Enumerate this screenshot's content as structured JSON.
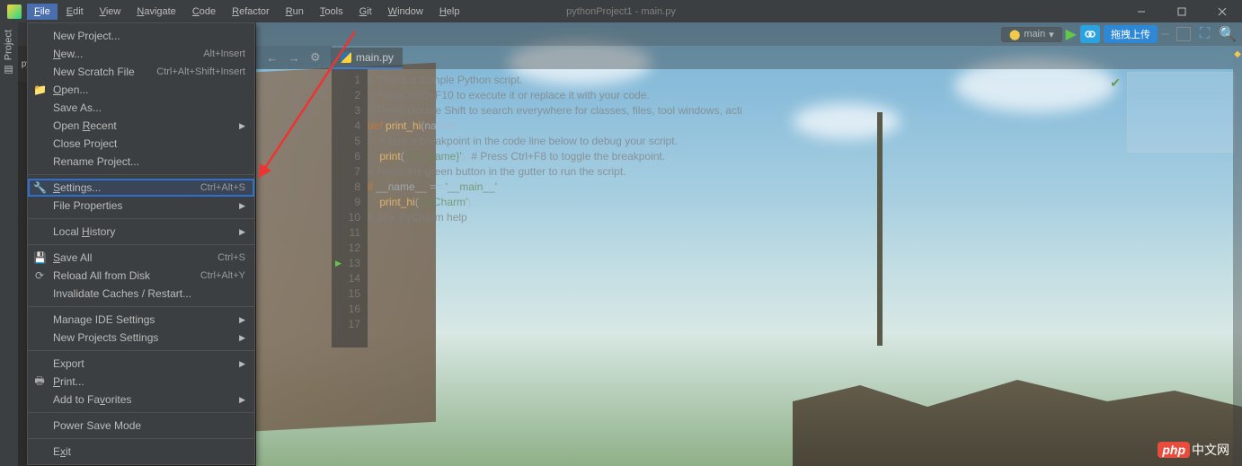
{
  "window_title": "pythonProject1 - main.py",
  "menubar": [
    "File",
    "Edit",
    "View",
    "Navigate",
    "Code",
    "Refactor",
    "Run",
    "Tools",
    "Git",
    "Window",
    "Help"
  ],
  "sidebar": {
    "project_label": "Project",
    "collapsed_badge": "py"
  },
  "run_config": {
    "name": "main"
  },
  "upload_button": "拖拽上传",
  "file_tab": "main.py",
  "breadcrumb_prefix": "pythonPro",
  "dropdown": {
    "groups": [
      [
        {
          "label": "New Project...",
          "shortcut": "",
          "icon": ""
        },
        {
          "label": "New...",
          "ul": 0,
          "shortcut": "Alt+Insert",
          "icon": ""
        },
        {
          "label": "New Scratch File",
          "shortcut": "Ctrl+Alt+Shift+Insert",
          "icon": ""
        },
        {
          "label": "Open...",
          "ul": 0,
          "shortcut": "",
          "icon": "folder"
        },
        {
          "label": "Save As...",
          "shortcut": "",
          "icon": ""
        },
        {
          "label": "Open Recent",
          "ul": 5,
          "shortcut": "",
          "icon": "",
          "submenu": true
        },
        {
          "label": "Close Project",
          "shortcut": "",
          "icon": ""
        },
        {
          "label": "Rename Project...",
          "shortcut": "",
          "icon": ""
        }
      ],
      [
        {
          "label": "Settings...",
          "ul": 0,
          "shortcut": "Ctrl+Alt+S",
          "icon": "wrench",
          "highlight": true
        },
        {
          "label": "File Properties",
          "shortcut": "",
          "icon": "",
          "submenu": true
        }
      ],
      [
        {
          "label": "Local History",
          "ul": 6,
          "shortcut": "",
          "icon": "",
          "submenu": true
        }
      ],
      [
        {
          "label": "Save All",
          "ul": 0,
          "shortcut": "Ctrl+S",
          "icon": "save"
        },
        {
          "label": "Reload All from Disk",
          "shortcut": "Ctrl+Alt+Y",
          "icon": "reload"
        },
        {
          "label": "Invalidate Caches / Restart...",
          "shortcut": "",
          "icon": ""
        }
      ],
      [
        {
          "label": "Manage IDE Settings",
          "shortcut": "",
          "icon": "",
          "submenu": true
        },
        {
          "label": "New Projects Settings",
          "shortcut": "",
          "icon": "",
          "submenu": true
        }
      ],
      [
        {
          "label": "Export",
          "shortcut": "",
          "icon": "",
          "submenu": true
        },
        {
          "label": "Print...",
          "ul": 0,
          "shortcut": "",
          "icon": "print"
        },
        {
          "label": "Add to Favorites",
          "ul": 9,
          "shortcut": "",
          "icon": "",
          "submenu": true
        }
      ],
      [
        {
          "label": "Power Save Mode",
          "shortcut": "",
          "icon": ""
        }
      ],
      [
        {
          "label": "Exit",
          "ul": 1,
          "shortcut": "",
          "icon": ""
        }
      ]
    ]
  },
  "code_lines": [
    {
      "n": 1,
      "t": "cm",
      "s": "# This is a sample Python script."
    },
    {
      "n": 2,
      "t": "",
      "s": ""
    },
    {
      "n": 3,
      "t": "cm",
      "s": "# Press Shift+F10 to execute it or replace it with your code."
    },
    {
      "n": 4,
      "t": "cm",
      "s": "# Press Double Shift to search everywhere for classes, files, tool windows, acti"
    },
    {
      "n": 5,
      "t": "",
      "s": ""
    },
    {
      "n": 6,
      "t": "",
      "s": ""
    },
    {
      "n": 7,
      "t": "def",
      "s": "def print_hi(name):"
    },
    {
      "n": 8,
      "t": "cm",
      "s": "    # Use a breakpoint in the code line below to debug your script."
    },
    {
      "n": 9,
      "t": "pr",
      "s": "    print(f'Hi, {name}')  # Press Ctrl+F8 to toggle the breakpoint."
    },
    {
      "n": 10,
      "t": "",
      "s": ""
    },
    {
      "n": 11,
      "t": "",
      "s": ""
    },
    {
      "n": 12,
      "t": "cm",
      "s": "# Press the green button in the gutter to run the script."
    },
    {
      "n": 13,
      "t": "if",
      "s": "if __name__ == '__main__':",
      "run": true
    },
    {
      "n": 14,
      "t": "cl",
      "s": "    print_hi('PyCharm')"
    },
    {
      "n": 15,
      "t": "",
      "s": ""
    },
    {
      "n": 16,
      "t": "cm",
      "s": "# See PyCharm help"
    },
    {
      "n": 17,
      "t": "",
      "s": ""
    }
  ],
  "watermark": {
    "badge": "php",
    "text": "中文网"
  }
}
